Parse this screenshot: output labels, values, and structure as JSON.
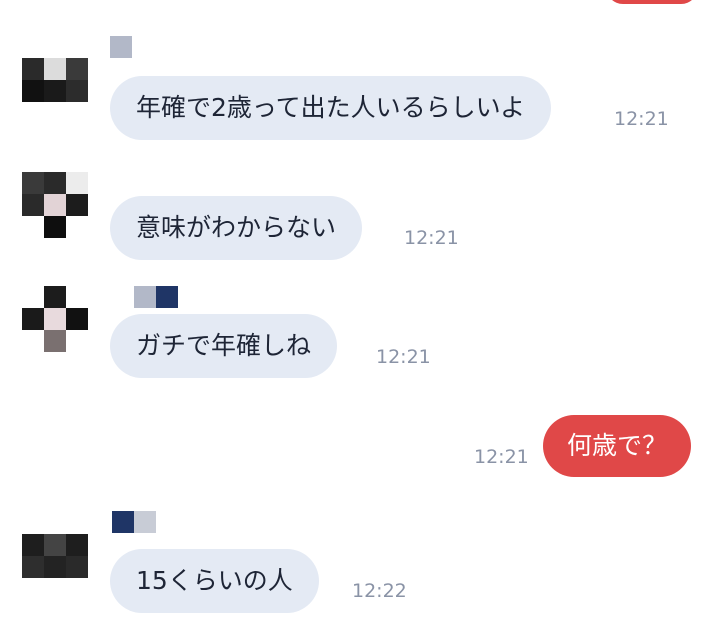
{
  "colors": {
    "incoming_bubble": "#e4eaf4",
    "outgoing_bubble": "#e04848",
    "incoming_text": "#1e2536",
    "outgoing_text": "#ffffff",
    "timestamp": "#8a93a6"
  },
  "messages": [
    {
      "side": "incoming",
      "text": "年確で2歳って出た人いるらしいよ",
      "time": "12:21"
    },
    {
      "side": "incoming",
      "text": "意味がわからない",
      "time": "12:21"
    },
    {
      "side": "incoming",
      "text": "ガチで年確しね",
      "time": "12:21"
    },
    {
      "side": "outgoing",
      "text": "何歳で？",
      "time": "12:21"
    },
    {
      "side": "incoming",
      "text": "15くらいの人",
      "time": "12:22"
    }
  ]
}
